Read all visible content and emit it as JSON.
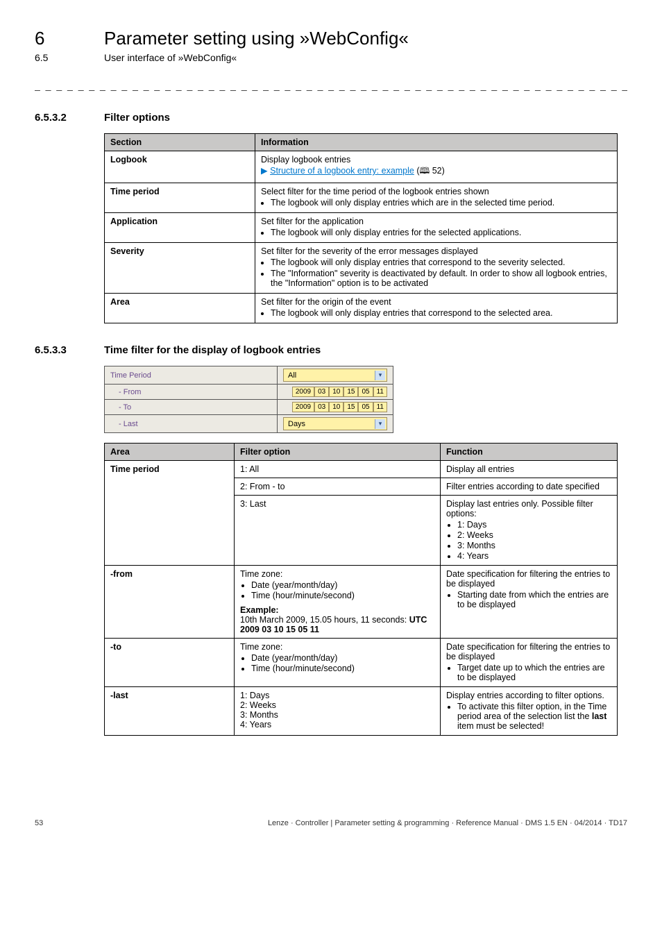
{
  "chapter": {
    "num": "6",
    "title": "Parameter setting using »WebConfig«"
  },
  "sub": {
    "num": "6.5",
    "title": "User interface of »WebConfig«"
  },
  "dashes": "_ _ _ _ _ _ _ _ _ _ _ _ _ _ _ _ _ _ _ _ _ _ _ _ _ _ _ _ _ _ _ _ _ _ _ _ _ _ _ _ _ _ _ _ _ _ _ _ _ _ _ _ _ _ _ _ _ _ _ _ _ _ _ _",
  "sec1": {
    "num": "6.5.3.2",
    "title": "Filter options"
  },
  "t1": {
    "h1": "Section",
    "h2": "Information",
    "r": [
      {
        "c1": "Logbook",
        "line": "Display logbook entries",
        "arrow": "▶",
        "link": "Structure of a logbook entry: example",
        "pageref": "(🕮 52)"
      },
      {
        "c1": "Time period",
        "line": "Select filter for the time period of the logbook entries shown",
        "b": [
          "The logbook will only display entries which are in the selected time period."
        ]
      },
      {
        "c1": "Application",
        "line": "Set filter for the application",
        "b": [
          "The logbook will only display entries for the selected applications."
        ]
      },
      {
        "c1": "Severity",
        "line": "Set filter for the severity of the error messages displayed",
        "b": [
          "The logbook will only display entries that correspond to the severity selected.",
          "The \"Information\" severity is deactivated by default. In order to show all logbook entries, the \"Information\" option is to be activated"
        ]
      },
      {
        "c1": "Area",
        "line": "Set filter for the origin of the event",
        "b": [
          "The logbook will only display entries that correspond to the selected area."
        ]
      }
    ]
  },
  "sec2": {
    "num": "6.5.3.3",
    "title": "Time filter for the display of logbook entries"
  },
  "fake": {
    "rows": [
      {
        "label": "Time Period",
        "type": "sel",
        "val": "All"
      },
      {
        "label": "- From",
        "type": "seg",
        "vals": [
          "2009",
          "03",
          "10",
          "15",
          "05",
          "11"
        ]
      },
      {
        "label": "- To",
        "type": "seg",
        "vals": [
          "2009",
          "03",
          "10",
          "15",
          "05",
          "11"
        ]
      },
      {
        "label": "- Last",
        "type": "sely",
        "val": "Days"
      }
    ]
  },
  "t2": {
    "h1": "Area",
    "h2": "Filter option",
    "h3": "Function",
    "rows": {
      "timeperiod_label": "Time period",
      "tp_r1": {
        "opt": "1: All",
        "fn": "Display all entries"
      },
      "tp_r2": {
        "opt": "2: From - to",
        "fn": "Filter entries according to date specified"
      },
      "tp_r3": {
        "opt": "3: Last",
        "fn_line": "Display last entries only. Possible filter options:",
        "fn_b": [
          "1: Days",
          "2: Weeks",
          "3: Months",
          "4: Years"
        ]
      },
      "from": {
        "label": "-from",
        "opt_line": "Time zone:",
        "opt_b": [
          "Date (year/month/day)",
          "Time (hour/minute/second)"
        ],
        "ex_label": "Example:",
        "ex_line1": "10th March 2009, 15.05 hours, 11 seconds: ",
        "ex_utc": "UTC    2009 03 10 15 05 11",
        "fn_line": "Date specification for filtering the entries to be displayed",
        "fn_b": [
          "Starting date from which the entries are to be displayed"
        ]
      },
      "to": {
        "label": "-to",
        "opt_line": "Time zone:",
        "opt_b": [
          "Date (year/month/day)",
          "Time (hour/minute/second)"
        ],
        "fn_line": "Date specification for filtering the entries to be displayed",
        "fn_b": [
          "Target date up to which the entries are to be displayed"
        ]
      },
      "last": {
        "label": "-last",
        "opt_lines": [
          "1: Days",
          "2: Weeks",
          "3: Months",
          "4: Years"
        ],
        "fn_line": "Display entries according to filter options.",
        "fn_b_pre": "To activate this filter option, in the Time period area of the selection list the ",
        "fn_b_bold": "last",
        "fn_b_post": " item must be selected!"
      }
    }
  },
  "footer": {
    "page": "53",
    "text": "Lenze · Controller | Parameter setting & programming · Reference Manual · DMS 1.5 EN · 04/2014 · TD17"
  }
}
